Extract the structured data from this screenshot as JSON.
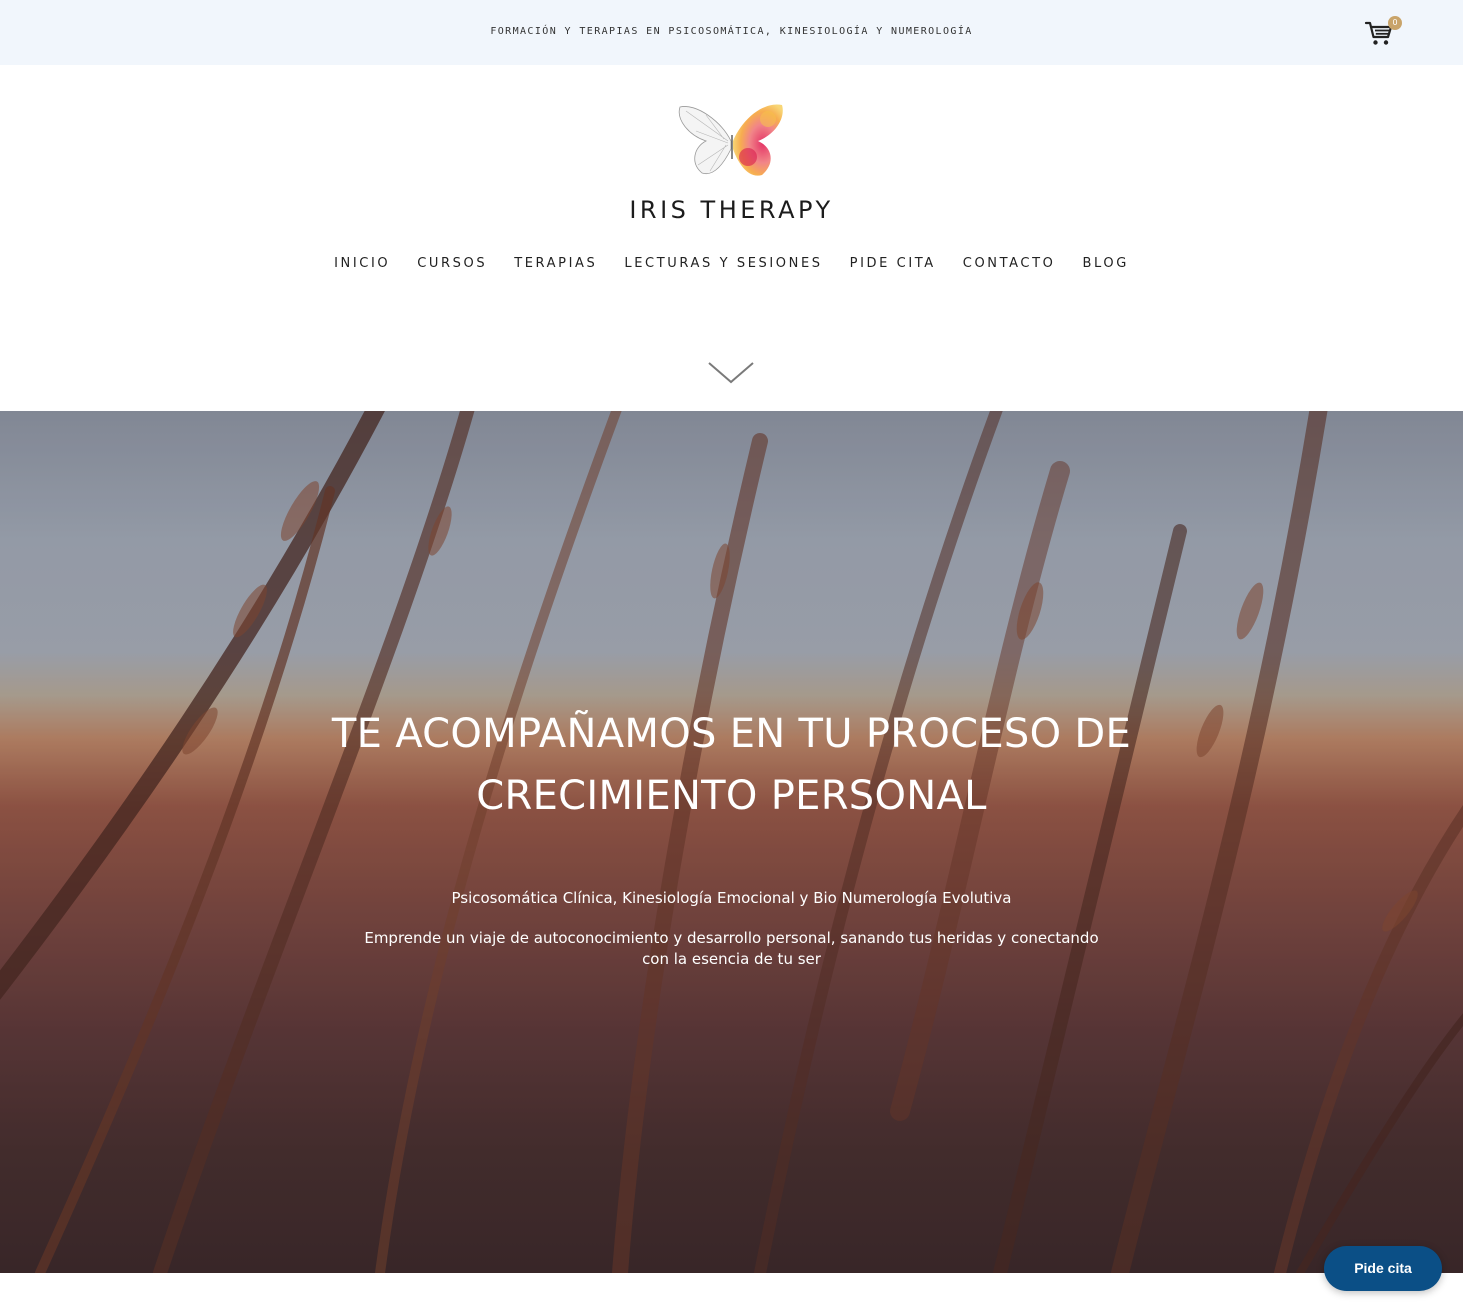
{
  "topbar": {
    "tagline": "FORMACIÓN Y TERAPIAS EN PSICOSOMÁTICA, KINESIOLOGÍA Y NUMEROLOGÍA",
    "cart_icon": "cart-icon",
    "cart_count": "0",
    "badge_color": "#c9a46a",
    "background": "#f1f6fc"
  },
  "header": {
    "logo_icon": "butterfly-logo-icon",
    "brand": "IRIS THERAPY",
    "nav": [
      {
        "label": "INICIO"
      },
      {
        "label": "CURSOS"
      },
      {
        "label": "TERAPIAS"
      },
      {
        "label": "LECTURAS Y SESIONES"
      },
      {
        "label": "PIDE CITA"
      },
      {
        "label": "CONTACTO"
      },
      {
        "label": "BLOG"
      }
    ],
    "scroll_icon": "chevron-down-icon"
  },
  "hero": {
    "title_line1": "TE ACOMPAÑAMOS EN TU PROCESO DE",
    "title_line2": "CRECIMIENTO PERSONAL",
    "subtitle": "Psicosomática Clínica, Kinesiología Emocional y Bio Numerología Evolutiva",
    "description": "Emprende un viaje de autoconocimiento y desarrollo personal, sanando tus heridas y conectando con la esencia de tu ser"
  },
  "floating_button": {
    "label": "Pide cita",
    "color": "#0b4f86"
  }
}
